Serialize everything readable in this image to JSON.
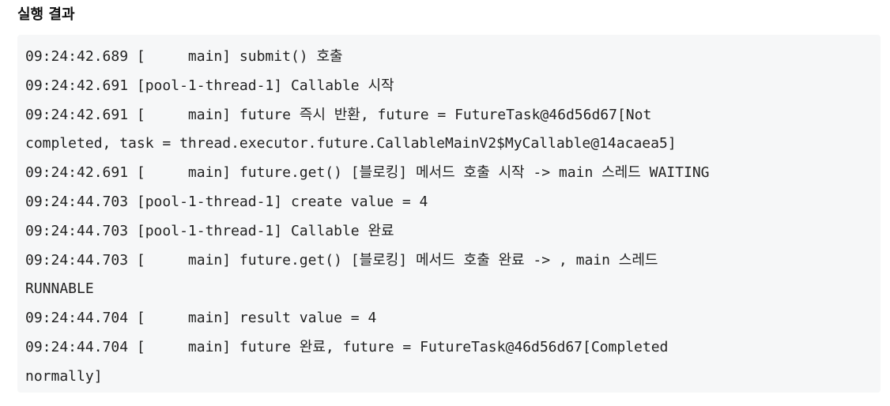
{
  "heading": "실행 결과",
  "output_lines": [
    "09:24:42.689 [     main] submit() 호출",
    "09:24:42.691 [pool-1-thread-1] Callable 시작",
    "09:24:42.691 [     main] future 즉시 반환, future = FutureTask@46d56d67[Not",
    "completed, task = thread.executor.future.CallableMainV2$MyCallable@14acaea5]",
    "09:24:42.691 [     main] future.get() [블로킹] 메서드 호출 시작 -> main 스레드 WAITING",
    "09:24:44.703 [pool-1-thread-1] create value = 4",
    "09:24:44.703 [pool-1-thread-1] Callable 완료",
    "09:24:44.703 [     main] future.get() [블로킹] 메서드 호출 완료 -> , main 스레드",
    "RUNNABLE",
    "09:24:44.704 [     main] result value = 4",
    "09:24:44.704 [     main] future 완료, future = FutureTask@46d56d67[Completed",
    "normally]"
  ]
}
